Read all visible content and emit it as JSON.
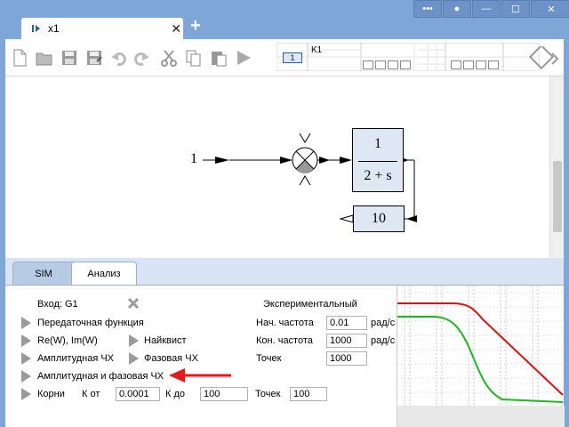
{
  "window": {
    "tab_title": "x1",
    "tab_close": "✕",
    "new_tab": "+",
    "buttons": {
      "menu": "•••",
      "record": "●",
      "minimize": "—",
      "maximize": "☐",
      "close": "✕"
    }
  },
  "toolbar": {
    "icons": [
      "new-file-icon",
      "open-folder-icon",
      "save-icon",
      "save-as-icon",
      "undo-icon",
      "redo-icon",
      "cut-icon",
      "copy-icon",
      "paste-icon",
      "run-icon"
    ],
    "block_value": "1",
    "block_label": "K1"
  },
  "diagram": {
    "input_value": "1",
    "tf_numerator": "1",
    "tf_denominator": "2 + s",
    "feedback_gain": "10",
    "block_fill": "#dde8f4"
  },
  "tabs": {
    "sim": "SIM",
    "analysis": "Анализ"
  },
  "analysis": {
    "input_label": "Вход: G1",
    "experimental": "Экспериментальный",
    "transfer_function": "Передаточная функция",
    "re_im": "Re(W), Im(W)",
    "nyquist": "Найквист",
    "amplitude": "Амплитудная ЧХ",
    "phase": "Фазовая ЧХ",
    "amp_phase": "Амплитудная и фазовая ЧХ",
    "roots": "Корни",
    "k_from_label": "К от",
    "k_from": "0.0001",
    "k_to_label": "К до",
    "k_to": "100",
    "points_label_roots": "Точек",
    "points_roots": "100",
    "start_freq_label": "Нач. частота",
    "start_freq": "0.01",
    "end_freq_label": "Кон. частота",
    "end_freq": "1000",
    "freq_unit": "рад/с",
    "points_label": "Точек",
    "points": "1000"
  },
  "colors": {
    "arrow": "#e8191c",
    "red_curve": "#e01010",
    "green_curve": "#1eb81e"
  }
}
